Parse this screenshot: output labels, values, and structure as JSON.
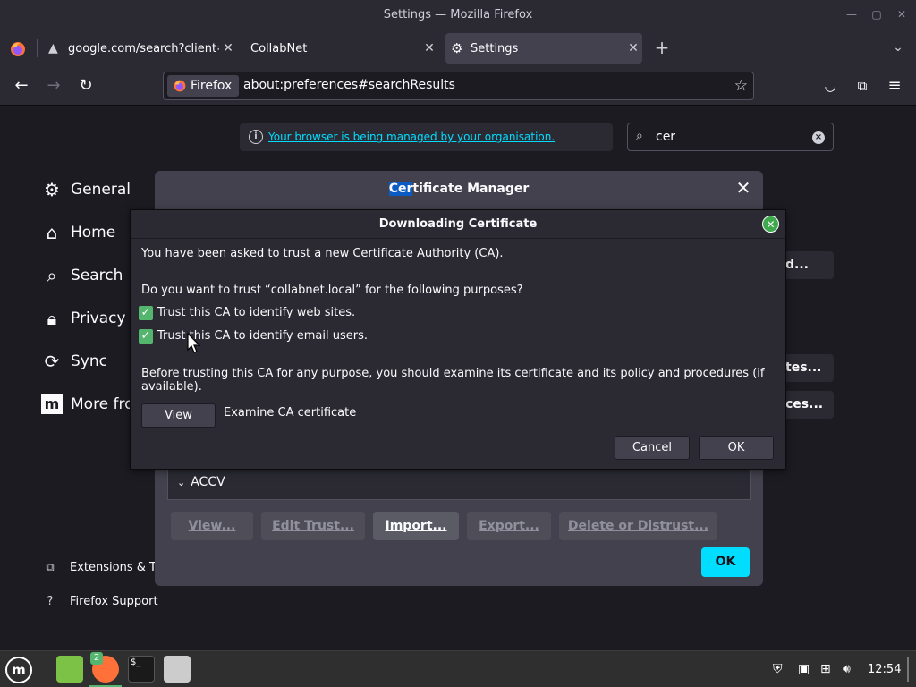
{
  "window": {
    "title": "Settings — Mozilla Firefox"
  },
  "tabs": [
    {
      "label": "google.com/search?client=",
      "icon": "warning-icon",
      "selected": false
    },
    {
      "label": "CollabNet",
      "icon": "none",
      "selected": false
    },
    {
      "label": "Settings",
      "icon": "gear-icon",
      "selected": true
    }
  ],
  "navbar": {
    "identity_label": "Firefox",
    "url": "about:preferences#searchResults"
  },
  "page": {
    "managed_notice": "Your browser is being managed by your organisation.",
    "search_value": "cer",
    "categories": [
      {
        "label": "General",
        "icon": "gear-icon"
      },
      {
        "label": "Home",
        "icon": "home-icon"
      },
      {
        "label": "Search",
        "icon": "search-icon"
      },
      {
        "label": "Privacy &",
        "icon": "lock-icon"
      },
      {
        "label": "Sync",
        "icon": "sync-icon"
      },
      {
        "label": "More fro",
        "icon": "mozilla-icon"
      }
    ],
    "footer": [
      {
        "label": "Extensions & Th",
        "icon": "puzzle-icon"
      },
      {
        "label": "Firefox Support",
        "icon": "help-icon"
      }
    ],
    "background_buttons": [
      "d...",
      "tes...",
      "ces..."
    ]
  },
  "cert_manager": {
    "title_highlight": "Cer",
    "title_rest": "tificate Manager",
    "tree_row": "ACCV",
    "buttons": [
      "View...",
      "Edit Trust...",
      "Import...",
      "Export...",
      "Delete or Distrust..."
    ],
    "ok_label": "OK"
  },
  "download_dialog": {
    "title": "Downloading Certificate",
    "intro": "You have been asked to trust a new Certificate Authority (CA).",
    "question": "Do you want to trust “collabnet.local” for the following purposes?",
    "checkbox_web": "Trust this CA to identify web sites.",
    "checkbox_email": "Trust this CA to identify email users.",
    "checkbox_web_checked": true,
    "checkbox_email_checked": true,
    "warning": "Before trusting this CA for any purpose, you should examine its certificate and its policy and procedures (if available).",
    "view_label": "View",
    "examine_label": "Examine CA certificate",
    "cancel_label": "Cancel",
    "ok_label": "OK"
  },
  "taskbar": {
    "firefox_badge": "2",
    "clock": "12:54"
  },
  "colors": {
    "accent": "#00ddff",
    "checkbox": "#53b56e",
    "highlight": "#0a5bc4",
    "background": "#1c1b22"
  }
}
